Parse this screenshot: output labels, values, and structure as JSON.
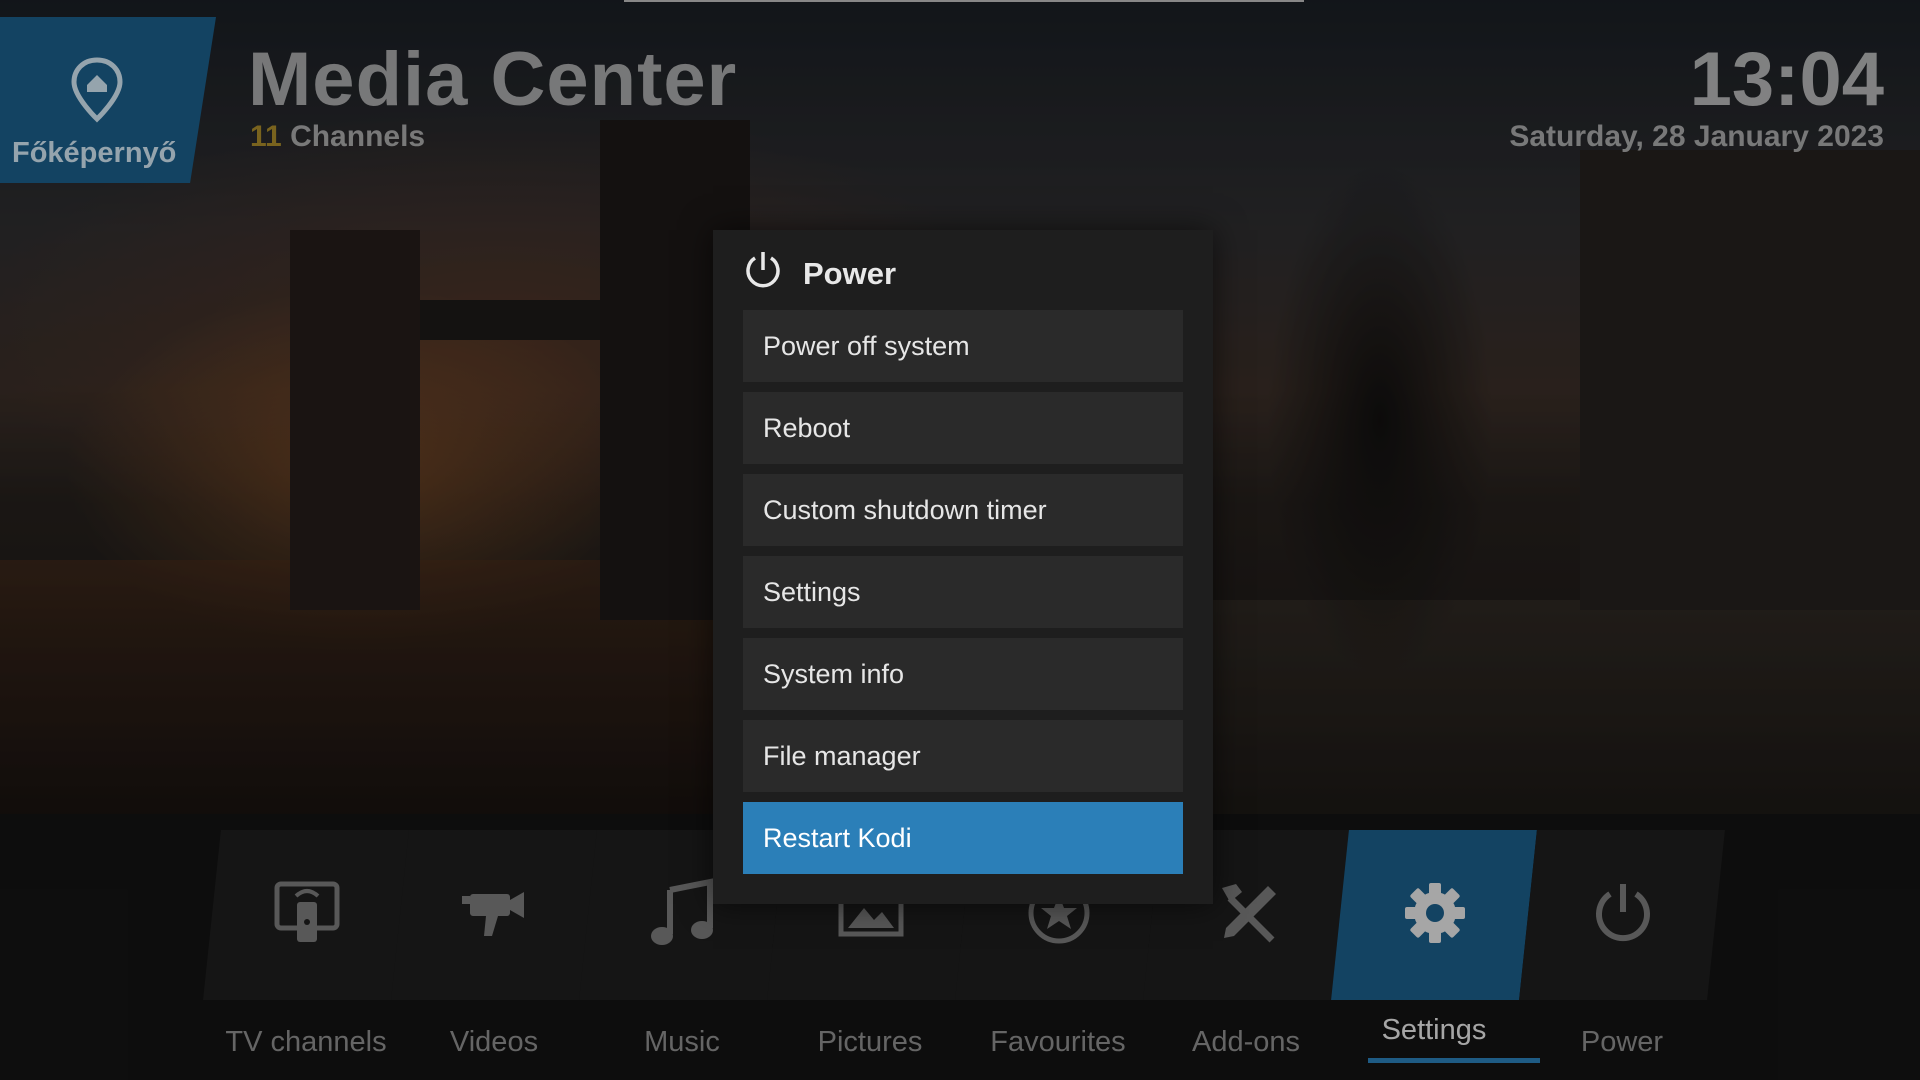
{
  "home": {
    "label": "Főképernyő",
    "icon": "home-pin-icon"
  },
  "header": {
    "title": "Media Center",
    "channels_count": "11",
    "channels_label": "Channels",
    "time": "13:04",
    "date": "Saturday, 28 January 2023"
  },
  "menu": {
    "items": [
      {
        "label": "TV channels",
        "icon": "tv-antenna-icon"
      },
      {
        "label": "Videos",
        "icon": "video-camera-icon"
      },
      {
        "label": "Music",
        "icon": "music-note-icon"
      },
      {
        "label": "Pictures",
        "icon": "picture-icon"
      },
      {
        "label": "Favourites",
        "icon": "star-icon"
      },
      {
        "label": "Add-ons",
        "icon": "tools-icon"
      },
      {
        "label": "Settings",
        "icon": "gear-icon"
      },
      {
        "label": "Power",
        "icon": "power-icon"
      }
    ],
    "active": "Settings"
  },
  "dialog": {
    "title": "Power",
    "icon": "power-icon",
    "options": [
      "Power off system",
      "Reboot",
      "Custom shutdown timer",
      "Settings",
      "System info",
      "File manager",
      "Restart Kodi"
    ],
    "selected": "Restart Kodi"
  },
  "colors": {
    "accent": "#1b5d88",
    "highlight": "#2b7fb8",
    "channel_count": "#a88a2a"
  }
}
